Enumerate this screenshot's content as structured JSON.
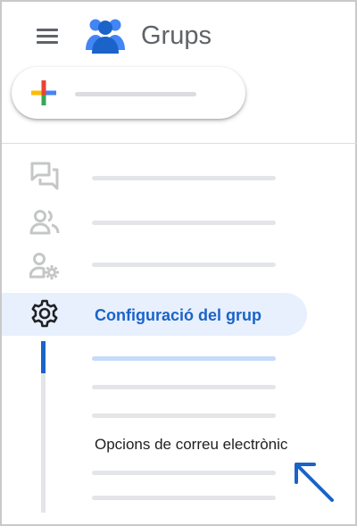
{
  "header": {
    "app_title": "Grups",
    "menu_icon": "hamburger-menu-icon",
    "logo_icon": "groups-logo-icon"
  },
  "create_button": {
    "icon": "plus-colored-icon"
  },
  "sidebar": {
    "items": [
      {
        "icon": "conversations-icon",
        "state": "dimmed"
      },
      {
        "icon": "members-icon",
        "state": "dimmed"
      },
      {
        "icon": "people-settings-icon",
        "state": "dimmed"
      }
    ],
    "active_item": {
      "label": "Configuració del grup",
      "icon": "settings-gear-icon"
    },
    "sub_items": {
      "highlighted_label": "Opcions de correu electrònic"
    }
  },
  "annotation": {
    "icon": "pointer-arrow-icon",
    "color": "#1a63c8"
  },
  "colors": {
    "accent": "#1a63c8",
    "active_bg": "#e8f0fe",
    "icon_gray": "#5f6368",
    "dim_gray": "#c4c7c5",
    "placeholder": "#e3e5e8"
  }
}
